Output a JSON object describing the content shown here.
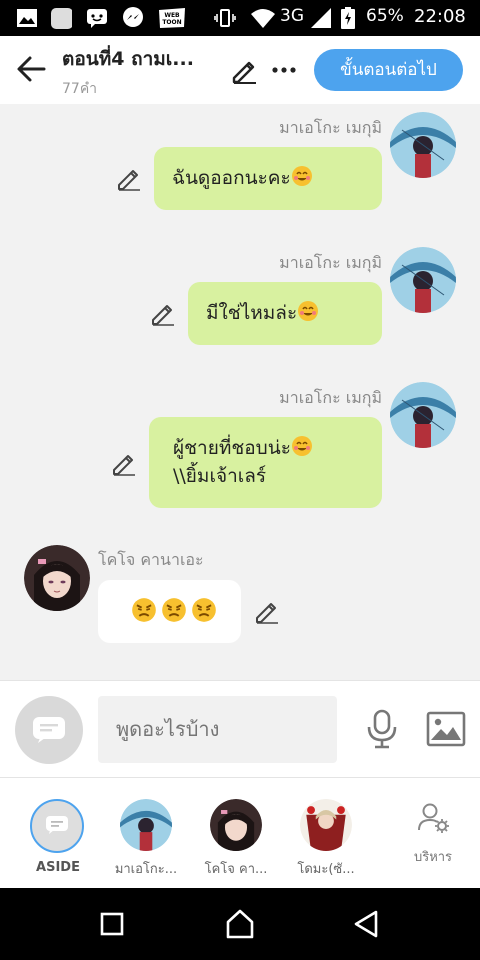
{
  "status_bar": {
    "network": "3G",
    "battery": "65%",
    "time": "22:08",
    "icons": [
      "gallery-icon",
      "app-icon",
      "messenger-chat-icon",
      "messenger-icon",
      "webtoon-icon",
      "vibrate-icon",
      "wifi-icon",
      "signal-icon",
      "battery-icon"
    ]
  },
  "header": {
    "title": "ตอนที่4 ถามเ...",
    "word_count": "77คำ",
    "next_button": "ขั้นตอนต่อไป"
  },
  "messages": [
    {
      "sender": "มาเอโกะ เมกุมิ",
      "text": "ฉันดูออกนะคะ",
      "side": "right"
    },
    {
      "sender": "มาเอโกะ เมกุมิ",
      "text": "มีใช่ไหมล่ะ",
      "side": "right"
    },
    {
      "sender": "มาเอโกะ เมกุมิ",
      "text_line1": "ผู้ชายที่ชอบน่ะ",
      "text_line2": "\\\\ยิ้มเจ้าเลร์",
      "side": "right"
    },
    {
      "sender": "โคโจ คานาเอะ",
      "text": "",
      "side": "left",
      "emojis": [
        "angry-face",
        "angry-face",
        "angry-face"
      ]
    }
  ],
  "composer": {
    "placeholder": "พูดอะไรบ้าง"
  },
  "characters": [
    {
      "label": "ASIDE"
    },
    {
      "label": "มาเอโกะ..."
    },
    {
      "label": "โคโจ คา..."
    },
    {
      "label": "โดมะ(ซั..."
    },
    {
      "label": "บริหาร"
    }
  ],
  "colors": {
    "accent": "#4da3ee",
    "bubble_green": "#d8f1a0",
    "background": "#f2f2f2"
  }
}
